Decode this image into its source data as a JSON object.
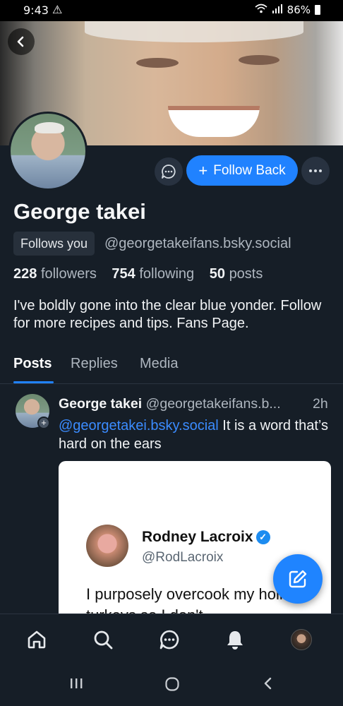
{
  "status_bar": {
    "time": "9:43",
    "battery": "86%"
  },
  "profile": {
    "display_name": "George takei",
    "follows_you_label": "Follows you",
    "handle": "@georgetakeifans.bsky.social",
    "followers_count": "228",
    "followers_label": "followers",
    "following_count": "754",
    "following_label": "following",
    "posts_count": "50",
    "posts_label": "posts",
    "bio": "I've boldly gone into the clear blue yonder. Follow for more recipes and tips. Fans Page.",
    "follow_button_label": "Follow Back"
  },
  "tabs": [
    {
      "label": "Posts",
      "active": true
    },
    {
      "label": "Replies",
      "active": false
    },
    {
      "label": "Media",
      "active": false
    }
  ],
  "post": {
    "author": "George takei",
    "handle": "@georgetakeifans.b...",
    "time": "2h",
    "mention": "@georgetakei.bsky.social",
    "text": "It is a word that’s hard on the ears",
    "embed": {
      "name": "Rodney Lacroix",
      "handle": "@RodLacroix",
      "text": "I purposely overcook my holiday turkeys so I don't"
    }
  },
  "colors": {
    "background": "#161e27",
    "accent": "#2082ff",
    "secondary_text": "#aeb6bf"
  },
  "icons": {
    "back": "chevron-left-icon",
    "message": "chat-bubble-icon",
    "more": "ellipsis-icon",
    "compose": "compose-icon",
    "nav": [
      "home-icon",
      "search-icon",
      "chat-icon",
      "bell-icon",
      "profile-avatar"
    ]
  }
}
